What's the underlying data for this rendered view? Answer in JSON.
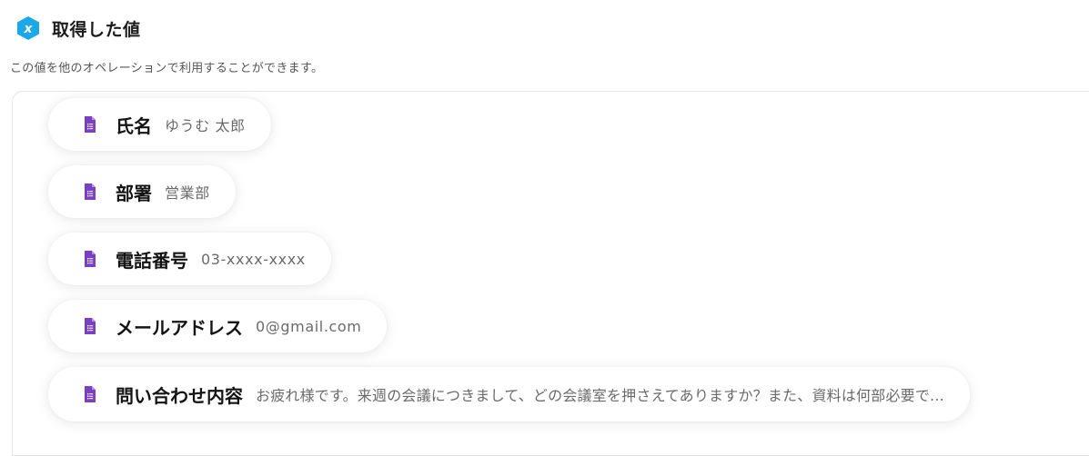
{
  "header": {
    "title": "取得した値",
    "subtitle": "この値を他のオペレーションで利用することができます。",
    "icon": "hexagon-x-icon",
    "accent_color": "#1aa8e8"
  },
  "fields": [
    {
      "label": "氏名",
      "value": "ゆうむ 太郎",
      "icon": "google-forms-icon"
    },
    {
      "label": "部署",
      "value": "営業部",
      "icon": "google-forms-icon"
    },
    {
      "label": "電話番号",
      "value": "03-xxxx-xxxx",
      "icon": "google-forms-icon"
    },
    {
      "label": "メールアドレス",
      "value": "0@gmail.com",
      "icon": "google-forms-icon"
    },
    {
      "label": "問い合わせ内容",
      "value": "お疲れ様です。来週の会議につきまして、どの会議室を押さえてありますか？また、資料は何部必要で...",
      "icon": "google-forms-icon"
    }
  ],
  "colors": {
    "forms_purple": "#7b3fc4"
  }
}
